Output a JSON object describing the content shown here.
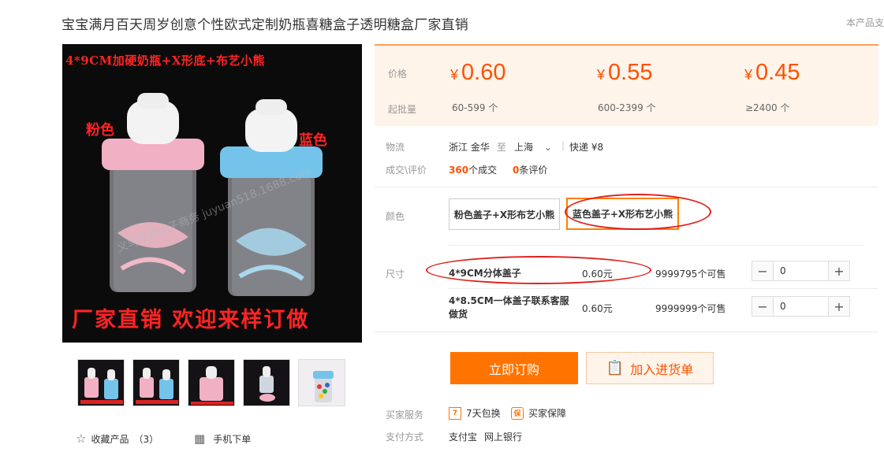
{
  "product": {
    "title": "宝宝满月百天周岁创意个性欧式定制奶瓶喜糖盒子透明糖盒厂家直销",
    "top_right": "本产品支"
  },
  "main_image": {
    "banner": "4*9CM加硬奶瓶+X形底+布艺小熊",
    "pink_label": "粉色",
    "blue_label": "蓝色",
    "bottom_text": "厂家直销 欢迎来样订做",
    "watermark": "义乌聚源电子商务 juyuan518.1688.com"
  },
  "thumbnails": [
    {
      "name": "thumbnail-1"
    },
    {
      "name": "thumbnail-2"
    },
    {
      "name": "thumbnail-3"
    },
    {
      "name": "thumbnail-4"
    },
    {
      "name": "thumbnail-5"
    }
  ],
  "favorite": {
    "label": "收藏产品",
    "count": "（3）"
  },
  "mobile_order": {
    "label": "手机下单"
  },
  "pricing": {
    "price_label": "价格",
    "moq_label": "起批量",
    "tiers": [
      {
        "currency": "¥",
        "price": "0.60",
        "qty": "60-599 个"
      },
      {
        "currency": "¥",
        "price": "0.55",
        "qty": "600-2399 个"
      },
      {
        "currency": "¥",
        "price": "0.45",
        "qty": "≥2400 个"
      }
    ]
  },
  "logistics": {
    "label": "物流",
    "from": "浙江 金华",
    "to_word": "至",
    "to": "上海",
    "express": "快递 ¥8"
  },
  "transactions": {
    "label": "成交\\评价",
    "deals_count": "360",
    "deals_word": "个成交",
    "reviews_count": "0",
    "reviews_word": "条评价"
  },
  "color": {
    "label": "颜色",
    "options": [
      "粉色盖子+X形布艺小熊",
      "蓝色盖子+X形布艺小熊"
    ],
    "selected_index": 1
  },
  "size": {
    "label": "尺寸",
    "rows": [
      {
        "name": "4*9CM分体盖子",
        "price": "0.60元",
        "stock": "9999795个可售",
        "qty": "0"
      },
      {
        "name": "4*8.5CM一体盖子联系客服做货",
        "price": "0.60元",
        "stock": "9999999个可售",
        "qty": "0"
      }
    ]
  },
  "actions": {
    "buy_now": "立即订购",
    "add_to_cart": "加入进货单"
  },
  "services": {
    "label": "买家服务",
    "items": [
      {
        "icon": "seven-day-return-icon",
        "glyph": "7",
        "text": "7天包换"
      },
      {
        "icon": "buyer-protection-icon",
        "glyph": "保",
        "text": "买家保障"
      }
    ]
  },
  "payment": {
    "label": "支付方式",
    "methods": [
      "支付宝",
      "网上银行"
    ]
  },
  "colors": {
    "accent": "#ff5000",
    "button": "#ff7300",
    "price_bg": "#fff4ea",
    "annotation": "#e0201d"
  }
}
